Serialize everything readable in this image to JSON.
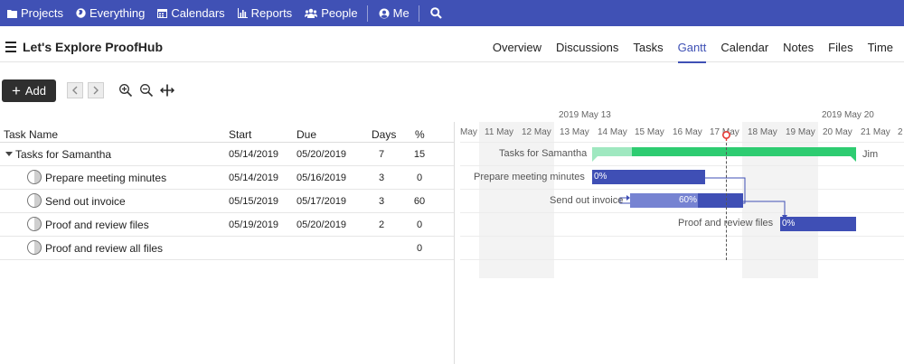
{
  "nav": {
    "items": [
      {
        "label": "Projects",
        "icon": "folder-icon"
      },
      {
        "label": "Everything",
        "icon": "globe-icon"
      },
      {
        "label": "Calendars",
        "icon": "calendar-icon"
      },
      {
        "label": "Reports",
        "icon": "bar-chart-icon"
      },
      {
        "label": "People",
        "icon": "people-icon"
      },
      {
        "label": "Me",
        "icon": "user-circle-icon"
      }
    ],
    "search_icon": "search-icon",
    "bg_color": "#4051b5"
  },
  "project": {
    "title": "Let's Explore ProofHub",
    "tabs": [
      "Overview",
      "Discussions",
      "Tasks",
      "Gantt",
      "Calendar",
      "Notes",
      "Files",
      "Time"
    ],
    "active_tab": "Gantt"
  },
  "toolbar": {
    "add_label": "Add",
    "prev_icon": "chevron-left-icon",
    "next_icon": "chevron-right-icon",
    "zoom_in_icon": "zoom-in-icon",
    "zoom_out_icon": "zoom-out-icon",
    "fit_icon": "fit-width-icon"
  },
  "grid": {
    "headers": {
      "name": "Task Name",
      "start": "Start",
      "due": "Due",
      "days": "Days",
      "pct": "%"
    },
    "rows": [
      {
        "name": "Tasks for Samantha",
        "start": "05/14/2019",
        "due": "05/20/2019",
        "days": "7",
        "pct": "15"
      },
      {
        "name": "Prepare meeting minutes",
        "start": "05/14/2019",
        "due": "05/16/2019",
        "days": "3",
        "pct": "0"
      },
      {
        "name": "Send out invoice",
        "start": "05/15/2019",
        "due": "05/17/2019",
        "days": "3",
        "pct": "60"
      },
      {
        "name": "Proof and review files",
        "start": "05/19/2019",
        "due": "05/20/2019",
        "days": "2",
        "pct": "0"
      },
      {
        "name": "Proof and review all files",
        "start": "",
        "due": "",
        "days": "",
        "pct": "0"
      }
    ]
  },
  "gantt": {
    "weeks": [
      "2019 May 13",
      "2019 May 20"
    ],
    "days": [
      "May",
      "11 May",
      "12 May",
      "13 May",
      "14 May",
      "15 May",
      "16 May",
      "17 May",
      "18 May",
      "19 May",
      "20 May",
      "21 May",
      "2"
    ],
    "weekend_days": [
      "11 May",
      "12 May",
      "18 May",
      "19 May"
    ],
    "today": "17 May",
    "bars": [
      {
        "label": "Tasks for Samantha",
        "assignee": "Jim",
        "progress": 0.15,
        "color": "#2ecc71",
        "light_color": "#9fe8c0"
      },
      {
        "label": "Prepare meeting minutes",
        "progress_label": "0%",
        "color": "#3f4fb5"
      },
      {
        "label": "Send out invoice",
        "progress_label": "60%",
        "progress": 0.6,
        "color": "#3f4fb5",
        "light_color": "#7683d2"
      },
      {
        "label": "Proof and review files",
        "progress_label": "0%",
        "color": "#3f4fb5"
      }
    ],
    "today_color": "#e53935"
  }
}
